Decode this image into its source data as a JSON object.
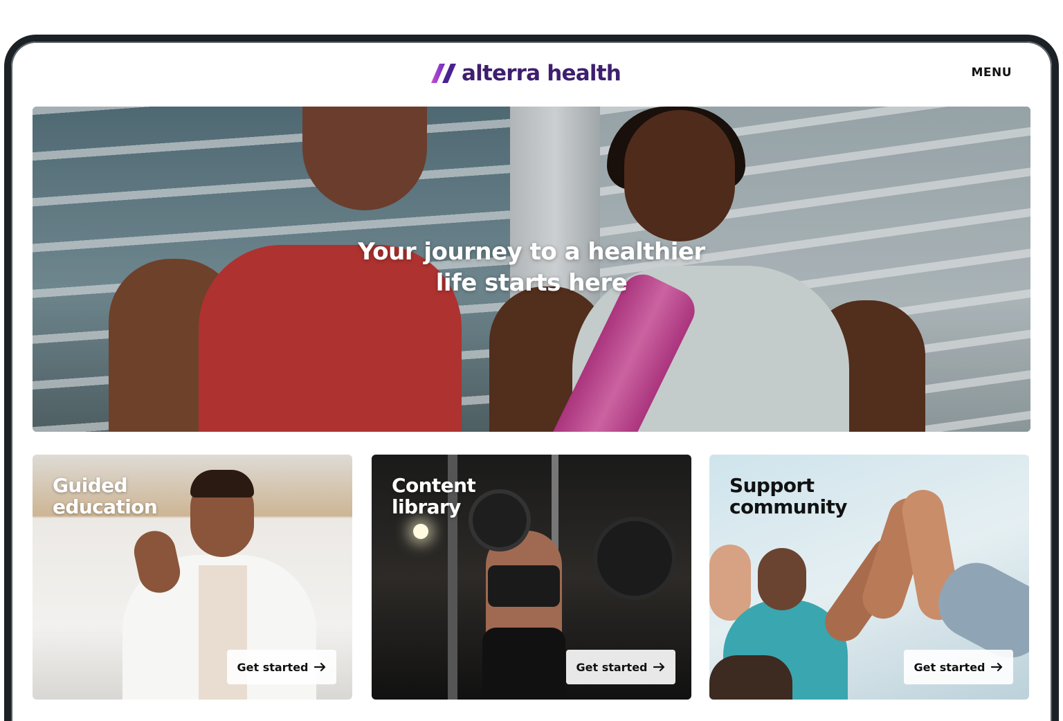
{
  "header": {
    "logo_text": "alterra health",
    "menu_label": "MENU"
  },
  "hero": {
    "title_line1": "Your journey to a healthier",
    "title_line2": "life starts here"
  },
  "cards": [
    {
      "title_line1": "Guided",
      "title_line2": "education",
      "cta_label": "Get started",
      "cta_icon": "arrow-right-icon"
    },
    {
      "title_line1": "Content",
      "title_line2": "library",
      "cta_label": "Get started",
      "cta_icon": "arrow-right-icon"
    },
    {
      "title_line1": "Support",
      "title_line2": "community",
      "cta_label": "Get started",
      "cta_icon": "arrow-right-icon"
    }
  ],
  "colors": {
    "brand_purple": "#3e1f6e",
    "logo_gradient_start": "#7b3fd1",
    "logo_gradient_end": "#c94fd0",
    "frame": "#1c2126"
  }
}
